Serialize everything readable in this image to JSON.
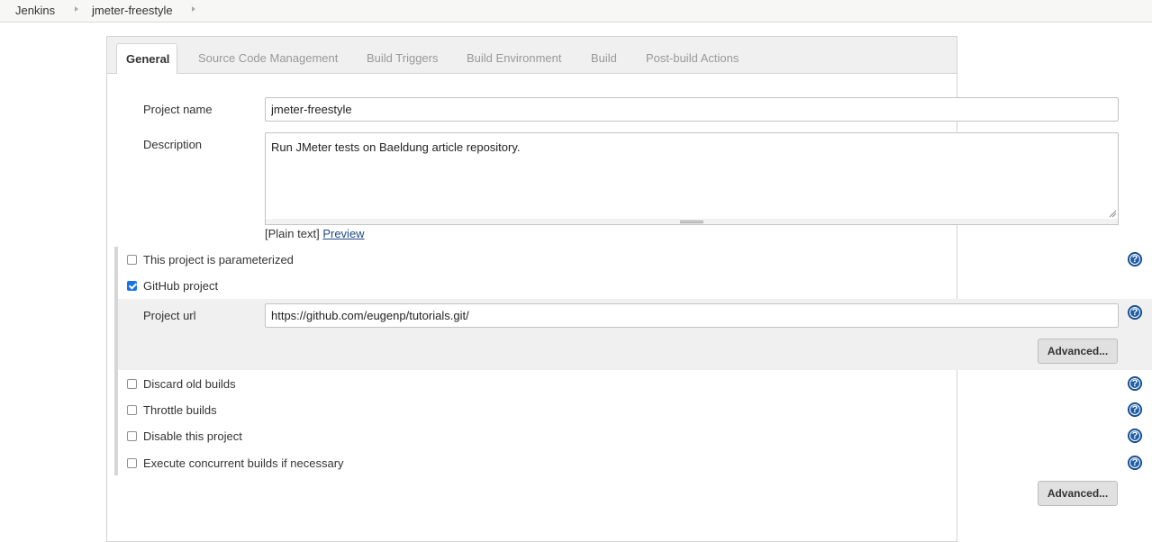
{
  "breadcrumb": {
    "items": [
      "Jenkins",
      "jmeter-freestyle"
    ]
  },
  "tabs": {
    "active": "General",
    "items": [
      "Source Code Management",
      "Build Triggers",
      "Build Environment",
      "Build",
      "Post-build Actions"
    ]
  },
  "project_name": {
    "label": "Project name",
    "value": "jmeter-freestyle"
  },
  "description": {
    "label": "Description",
    "value": "Run JMeter tests on Baeldung article repository.",
    "format_prefix": "[Plain text]",
    "preview_link": "Preview"
  },
  "options": {
    "parameterized": {
      "label": "This project is parameterized",
      "checked": false
    },
    "github_project": {
      "label": "GitHub project",
      "checked": true
    },
    "discard_old_builds": {
      "label": "Discard old builds",
      "checked": false
    },
    "throttle_builds": {
      "label": "Throttle builds",
      "checked": false
    },
    "disable_project": {
      "label": "Disable this project",
      "checked": false
    },
    "concurrent_builds": {
      "label": "Execute concurrent builds if necessary",
      "checked": false
    }
  },
  "project_url": {
    "label": "Project url",
    "value": "https://github.com/eugenp/tutorials.git/"
  },
  "buttons": {
    "advanced_github": "Advanced...",
    "advanced_general": "Advanced..."
  },
  "help_icon_glyph": "?",
  "colors": {
    "accent": "#1f5fa8",
    "link": "#204a87",
    "checkbox_checked": "#1a73e8"
  }
}
